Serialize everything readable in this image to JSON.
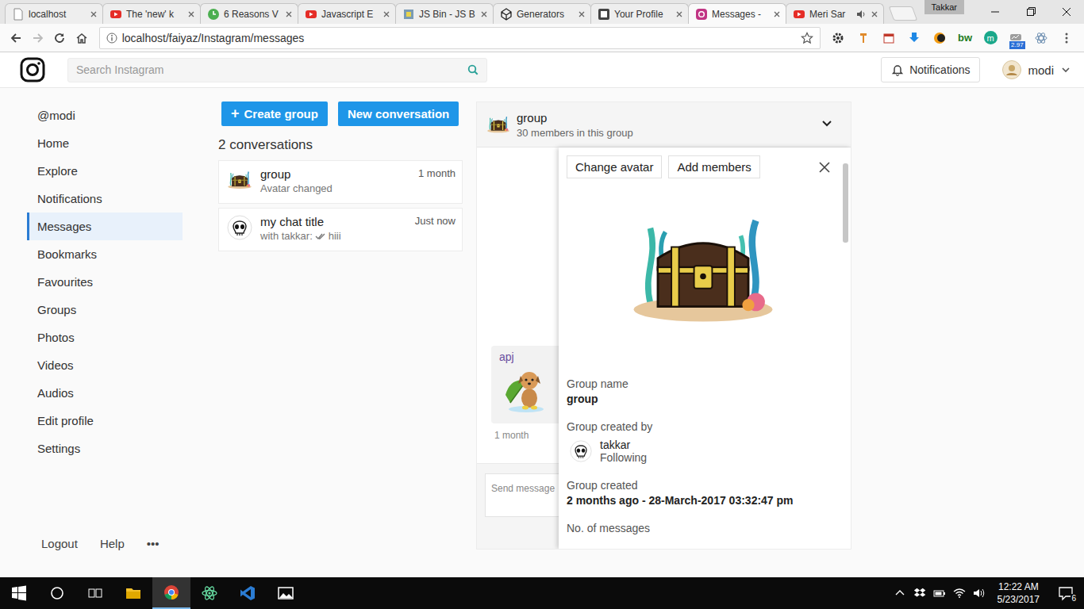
{
  "browser": {
    "tabs": [
      {
        "label": "localhost",
        "kind": "page",
        "selected": false,
        "audio": false
      },
      {
        "label": "The 'new' k",
        "kind": "youtube",
        "selected": false,
        "audio": false
      },
      {
        "label": "6 Reasons V",
        "kind": "timer",
        "selected": false,
        "audio": false
      },
      {
        "label": "Javascript E",
        "kind": "youtube",
        "selected": false,
        "audio": false
      },
      {
        "label": "JS Bin - JS B",
        "kind": "jsbin",
        "selected": false,
        "audio": false
      },
      {
        "label": "Generators",
        "kind": "codepen",
        "selected": false,
        "audio": false
      },
      {
        "label": "Your Profile",
        "kind": "hashnode",
        "selected": false,
        "audio": false
      },
      {
        "label": "Messages -",
        "kind": "instagram",
        "selected": true,
        "audio": false
      },
      {
        "label": "Meri Sar",
        "kind": "youtube",
        "selected": false,
        "audio": true
      }
    ],
    "profile": "Takkar",
    "address": "localhost/faiyaz/Instagram/messages",
    "bookmarked": false,
    "extensions": [
      {
        "kind": "gear"
      },
      {
        "kind": "pin"
      },
      {
        "kind": "calendar"
      },
      {
        "kind": "download"
      },
      {
        "kind": "circle"
      },
      {
        "kind": "bw",
        "label": "bw"
      },
      {
        "kind": "medium",
        "label": "m"
      },
      {
        "kind": "meter",
        "label": "2.97"
      },
      {
        "kind": "react"
      },
      {
        "kind": "menu"
      }
    ]
  },
  "header": {
    "search": {
      "placeholder": "Search Instagram"
    },
    "notifications": "Notifications",
    "user": "modi"
  },
  "sidebar": {
    "items": [
      {
        "label": "@modi",
        "selected": false
      },
      {
        "label": "Home",
        "selected": false
      },
      {
        "label": "Explore",
        "selected": false
      },
      {
        "label": "Notifications",
        "selected": false
      },
      {
        "label": "Messages",
        "selected": true
      },
      {
        "label": "Bookmarks",
        "selected": false
      },
      {
        "label": "Favourites",
        "selected": false
      },
      {
        "label": "Groups",
        "selected": false
      },
      {
        "label": "Photos",
        "selected": false
      },
      {
        "label": "Videos",
        "selected": false
      },
      {
        "label": "Audios",
        "selected": false
      },
      {
        "label": "Edit profile",
        "selected": false
      },
      {
        "label": "Settings",
        "selected": false
      }
    ],
    "footer": [
      "Logout",
      "Help",
      "•••"
    ]
  },
  "conversations": {
    "buttons": [
      {
        "icon": "+",
        "label": "Create group"
      },
      {
        "label": "New conversation"
      }
    ],
    "count": "2 conversations",
    "items": [
      {
        "title": "group",
        "kind": "group",
        "preview": "Avatar changed",
        "time": "1 month"
      },
      {
        "title": "my chat title",
        "kind": "direct",
        "preview": "with takkar:",
        "seen": true,
        "message": "hiii",
        "time": "Just now"
      }
    ]
  },
  "chat": {
    "title": "group",
    "subtitle": "30 members in this group",
    "expanded": true,
    "messages": [
      {
        "sender": "apj",
        "kind": "sticker",
        "time": "1 month"
      }
    ],
    "input": {
      "placeholder": "Send message"
    },
    "details": {
      "buttons": [
        "Change avatar",
        "Add members"
      ],
      "fields": [
        {
          "kind": "text",
          "label": "Group name",
          "value": "group"
        },
        {
          "kind": "user",
          "label": "Group created by",
          "user": "takkar",
          "relation": "Following"
        },
        {
          "kind": "text",
          "label": "Group created",
          "value": "2 months ago - 28-March-2017 03:32:47 pm"
        },
        {
          "kind": "label",
          "label": "No. of messages"
        }
      ]
    }
  },
  "taskbar": {
    "apps": [
      {
        "kind": "folder",
        "selected": false
      },
      {
        "kind": "browser",
        "selected": true
      },
      {
        "kind": "atom",
        "selected": false
      },
      {
        "kind": "editor",
        "selected": false
      },
      {
        "kind": "photos",
        "selected": false
      }
    ],
    "time": "12:22 AM",
    "date": "5/23/2017",
    "notifications": "6"
  }
}
